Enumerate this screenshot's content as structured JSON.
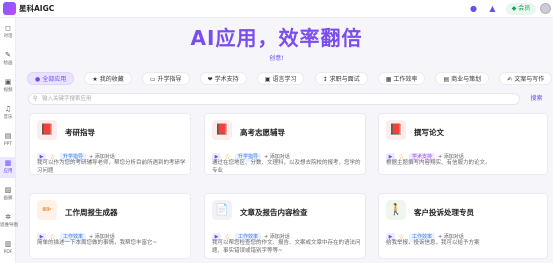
{
  "app": {
    "title": "星科AIGC"
  },
  "topbar": {
    "vip_label": "会员",
    "icons": [
      "chat-bubble-icon",
      "bell-icon",
      "user-icon"
    ]
  },
  "sidebar": {
    "items": [
      {
        "label": "对话",
        "icon": "◻"
      },
      {
        "label": "绘画",
        "icon": "✎"
      },
      {
        "label": "视频",
        "icon": "▣"
      },
      {
        "label": "音乐",
        "icon": "♫"
      },
      {
        "label": "PPT",
        "icon": "▤"
      },
      {
        "label": "应用",
        "icon": "▦"
      },
      {
        "label": "画廊",
        "icon": "▨"
      },
      {
        "label": "思维导图",
        "icon": "✲"
      },
      {
        "label": "PDF",
        "icon": "▥"
      }
    ]
  },
  "hero": {
    "title": "AI应用，效率翻倍",
    "subtitle": "创意!"
  },
  "tabs": [
    {
      "label": "全部应用",
      "icon": "●"
    },
    {
      "label": "我的收藏",
      "icon": "★"
    },
    {
      "label": "升学指导",
      "icon": "▭"
    },
    {
      "label": "学术支持",
      "icon": "❤"
    },
    {
      "label": "语言学习",
      "icon": "▣"
    },
    {
      "label": "求职与面试",
      "icon": "↕"
    },
    {
      "label": "工作效率",
      "icon": "▦"
    },
    {
      "label": "商业与策划",
      "icon": "▤"
    },
    {
      "label": "文案与写作",
      "icon": "✍"
    },
    {
      "label": "",
      "icon": "▣"
    }
  ],
  "search": {
    "placeholder": "输入关键字搜索应用",
    "button_label": "搜索"
  },
  "cards": [
    {
      "title": "考研指导",
      "icon": "📕",
      "badge": "升学指导",
      "add_label": "添加对话",
      "desc": "我可以作为您的考研辅导老师，帮您分析目前所遇到的考研学习问题"
    },
    {
      "title": "高考志愿辅导",
      "icon": "📕",
      "badge": "升学指导",
      "add_label": "添加对话",
      "desc": "通过在您地区、分数、文理科，以及想去院校的报考，您学的专业"
    },
    {
      "title": "撰写论文",
      "icon": "📕",
      "badge": "学术支持",
      "add_label": "添加对话",
      "desc": "根据主题撰写内容翔实、有信服力的论文。"
    },
    {
      "title": "工作周报生成器",
      "icon": "✏",
      "badge": "工作效率",
      "add_label": "添加对话",
      "desc": "简单的描述一下本周您做的事情，我帮您丰富它~"
    },
    {
      "title": "文章及报告内容检查",
      "icon": "📄",
      "badge": "工作效率",
      "add_label": "添加对话",
      "desc": "我可以帮您检查您的作文、报告、文案或文章中存在的语法问题、事实错误或错别字等等~"
    },
    {
      "title": "客户投诉处理专员",
      "icon": "🚶",
      "badge": "工作效率",
      "add_label": "添加对话",
      "desc": "给我举报，投诉信息，我可以给予方案"
    }
  ]
}
